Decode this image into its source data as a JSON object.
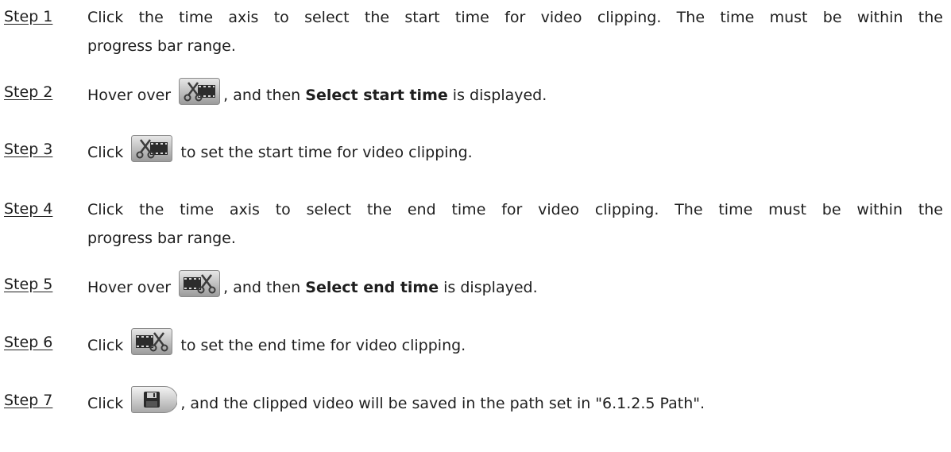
{
  "steps": [
    {
      "label": "Step 1",
      "line1": "Click the time axis to select the start time for video clipping. The time must be within the",
      "line2": "progress bar range."
    },
    {
      "label": "Step 2",
      "before": "Hover over",
      "after_pre": ", and then ",
      "bold": "Select start time",
      "after_post": " is displayed.",
      "icon": "clip-start-icon"
    },
    {
      "label": "Step 3",
      "before": "Click",
      "after": " to set the start time for video clipping.",
      "icon": "clip-start-icon"
    },
    {
      "label": "Step 4",
      "line1": "Click the time axis to select the end time for video clipping. The time must be within the",
      "line2": "progress bar range."
    },
    {
      "label": "Step 5",
      "before": "Hover over",
      "after_pre": ", and then ",
      "bold": "Select end time",
      "after_post": " is displayed.",
      "icon": "clip-end-icon"
    },
    {
      "label": "Step 6",
      "before": "Click",
      "after": " to set the end time for video clipping.",
      "icon": "clip-end-icon"
    },
    {
      "label": "Step 7",
      "before": "Click",
      "after": ", and the clipped video will be saved in the path set in \"6.1.2.5 Path\".",
      "icon": "save-icon"
    }
  ]
}
